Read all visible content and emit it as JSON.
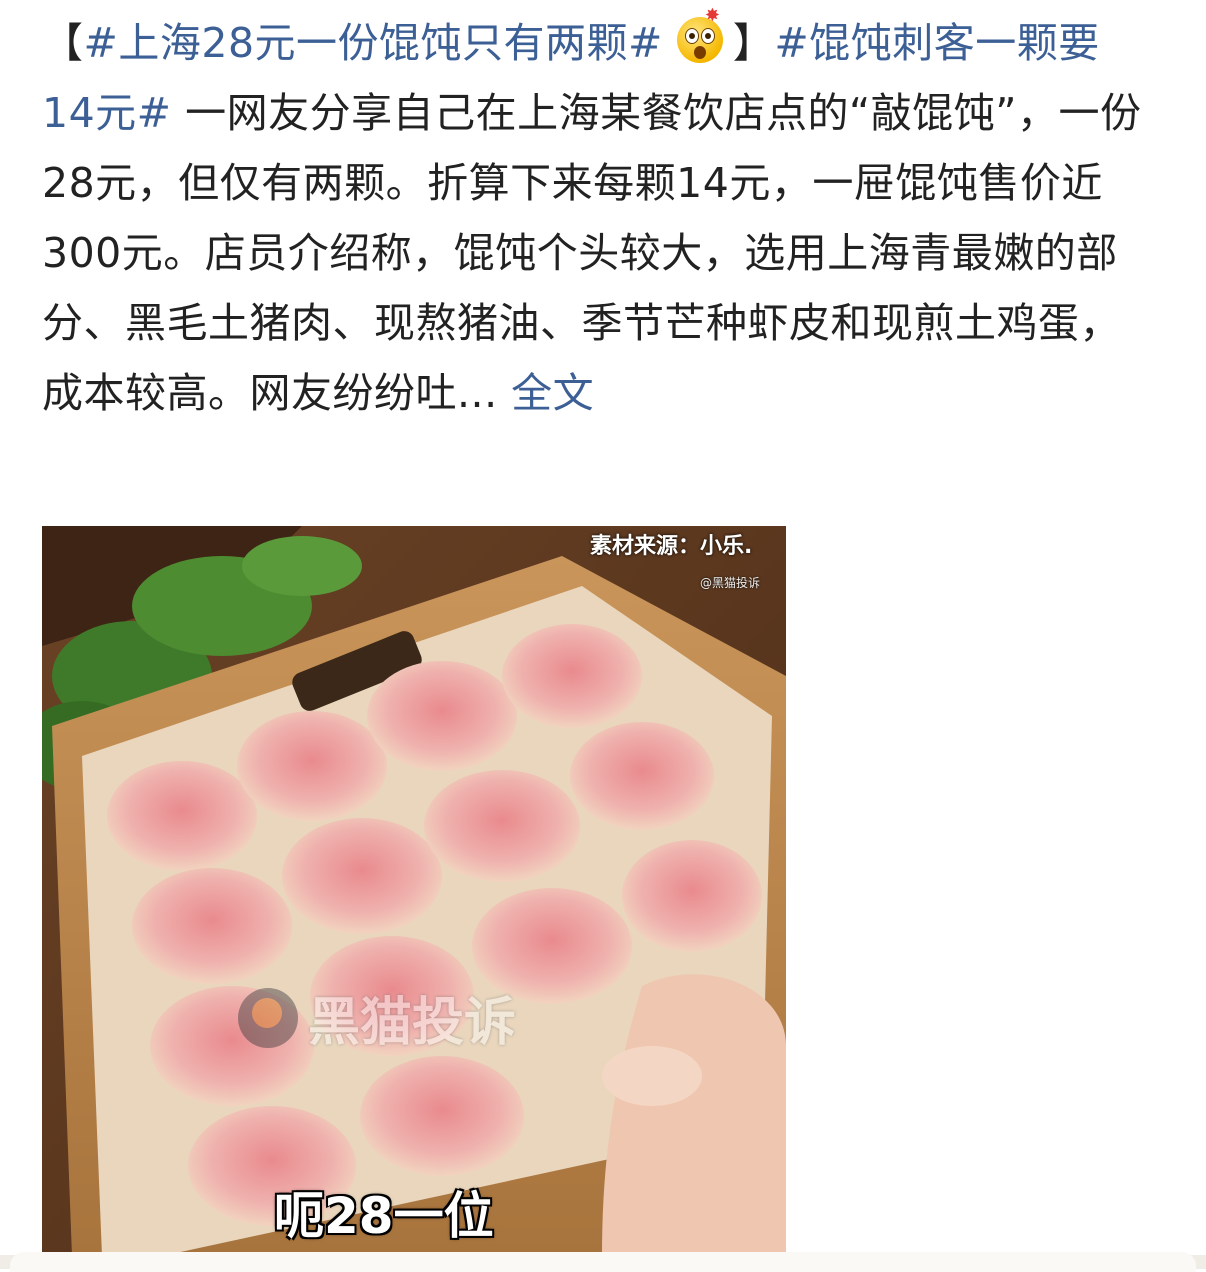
{
  "post": {
    "lead_open": "【",
    "hashtag1": "#上海28元一份馄饨只有两颗#",
    "emoji": "astonished-face-emoji",
    "lead_close": "】",
    "hashtag2": "#馄饨刺客一颗要14元#",
    "body": " 一网友分享自己在上海某餐饮店点的“敲馄饨”，一份28元，但仅有两颗。折算下来每颗14元，一屉馄饨售价近300元。店员介绍称，馄饨个头较大，选用上海青最嫩的部分、黑毛土猪肉、现熬猪油、季节芒种虾皮和现煎土鸡蛋，成本较高。网友纷纷吐...",
    "full_text_link": "全文"
  },
  "media": {
    "source_caption": "素材来源：小乐.",
    "small_watermark": "@黑猫投诉",
    "watermark": "黑猫投诉",
    "subtitle": "呃28一位"
  },
  "colors": {
    "link": "#3c5f95",
    "text": "#222222"
  }
}
